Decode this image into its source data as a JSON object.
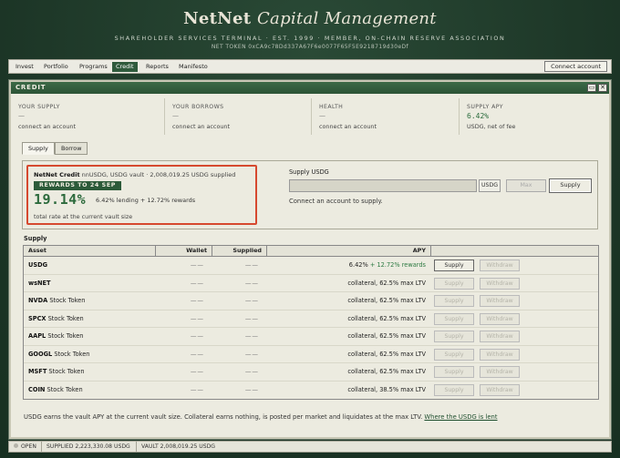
{
  "header": {
    "brand_main": "NetNet",
    "brand_italic": "Capital Management",
    "tagline": "SHAREHOLDER SERVICES TERMINAL · EST. 1999 · MEMBER, ON-CHAIN RESERVE ASSOCIATION",
    "token": "NET TOKEN 0xCA9c78Dd337A67F6e0077F65F5E9218719d30eDf"
  },
  "menu": {
    "items": [
      "Invest",
      "Portfolio",
      "Programs",
      "Credit",
      "Reports",
      "Manifesto"
    ],
    "active": "Credit",
    "connect_label": "Connect account"
  },
  "window": {
    "title": "CREDIT",
    "minimize_glyph": "▭",
    "close_glyph": "✕"
  },
  "stats": {
    "supply": {
      "label": "YOUR SUPPLY",
      "value": "—",
      "note": "connect an account"
    },
    "borrows": {
      "label": "YOUR BORROWS",
      "value": "—",
      "note": "connect an account"
    },
    "health": {
      "label": "HEALTH",
      "value": "—",
      "note": "connect an account"
    },
    "apy": {
      "label": "SUPPLY APY",
      "value": "6.42%",
      "note": "USDG, net of fee"
    }
  },
  "tabs": [
    "Supply",
    "Borrow"
  ],
  "credit": {
    "title": "NetNet Credit",
    "subtitle": "nnUSDG, USDG vault · 2,008,019.25 USDG supplied",
    "badge": "REWARDS TO 24 SEP",
    "total_apy": "19.14%",
    "detail": "6.42% lending + 12.72% rewards",
    "caption": "total rate at the current vault size"
  },
  "supply_form": {
    "label": "Supply USDG",
    "placeholder": "",
    "unit": "USDG",
    "max_label": "Max",
    "supply_label": "Supply",
    "hint": "Connect an account to supply."
  },
  "table": {
    "section_label": "Supply",
    "columns": [
      "Asset",
      "Wallet",
      "Supplied",
      "APY"
    ],
    "supply_label": "Supply",
    "withdraw_label": "Withdraw",
    "rows": [
      {
        "symbol": "USDG",
        "kind": "",
        "wallet": "——",
        "supplied": "——",
        "apy": "6.42%",
        "rewards": "+ 12.72% rewards",
        "enabled": true
      },
      {
        "symbol": "wsNET",
        "kind": "",
        "wallet": "——",
        "supplied": "——",
        "apy": "collateral, 62.5% max LTV",
        "rewards": "",
        "enabled": false
      },
      {
        "symbol": "NVDA",
        "kind": "Stock Token",
        "wallet": "——",
        "supplied": "——",
        "apy": "collateral, 62.5% max LTV",
        "rewards": "",
        "enabled": false
      },
      {
        "symbol": "SPCX",
        "kind": "Stock Token",
        "wallet": "——",
        "supplied": "——",
        "apy": "collateral, 62.5% max LTV",
        "rewards": "",
        "enabled": false
      },
      {
        "symbol": "AAPL",
        "kind": "Stock Token",
        "wallet": "——",
        "supplied": "——",
        "apy": "collateral, 62.5% max LTV",
        "rewards": "",
        "enabled": false
      },
      {
        "symbol": "GOOGL",
        "kind": "Stock Token",
        "wallet": "——",
        "supplied": "——",
        "apy": "collateral, 62.5% max LTV",
        "rewards": "",
        "enabled": false
      },
      {
        "symbol": "MSFT",
        "kind": "Stock Token",
        "wallet": "——",
        "supplied": "——",
        "apy": "collateral, 62.5% max LTV",
        "rewards": "",
        "enabled": false
      },
      {
        "symbol": "COIN",
        "kind": "Stock Token",
        "wallet": "——",
        "supplied": "——",
        "apy": "collateral, 38.5% max LTV",
        "rewards": "",
        "enabled": false
      }
    ]
  },
  "footer": {
    "note": "USDG earns the vault APY at the current vault size. Collateral earns nothing, is posted per market and liquidates at the max LTV.",
    "link": "Where the USDG is lent"
  },
  "statusbar": {
    "state": "OPEN",
    "supplied": "SUPPLIED 2,223,330.08 USDG",
    "vault": "VAULT 2,008,019.25 USDG"
  },
  "colors": {
    "accent_green": "#2c5a39",
    "highlight_red": "#d6492f",
    "reward_green": "#2d7a42"
  }
}
